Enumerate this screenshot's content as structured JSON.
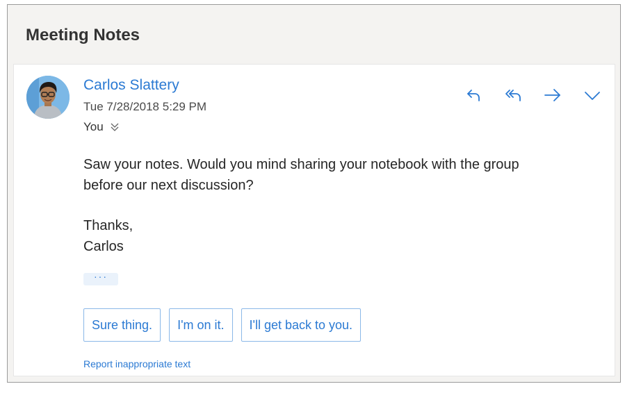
{
  "message": {
    "subject": "Meeting Notes",
    "sender_name": "Carlos Slattery",
    "date": "Tue 7/28/2018 5:29 PM",
    "recipient": "You",
    "body_lines": [
      "Saw your notes. Would you mind sharing your notebook with the group",
      "before our next discussion?"
    ],
    "signoff_lines": [
      "Thanks,",
      "Carlos"
    ],
    "more_label": "···"
  },
  "actions": {
    "icons": [
      "reply-icon",
      "reply-all-icon",
      "forward-icon",
      "chevron-down-icon"
    ]
  },
  "suggested_replies": [
    "Sure thing.",
    "I'm on it.",
    "I'll get back to you."
  ],
  "report_link": "Report inappropriate text",
  "colors": {
    "accent": "#2b7ad3",
    "frame_bg": "#f4f3f1",
    "card_bg": "#ffffff",
    "reply_border": "#8ab8e8"
  }
}
